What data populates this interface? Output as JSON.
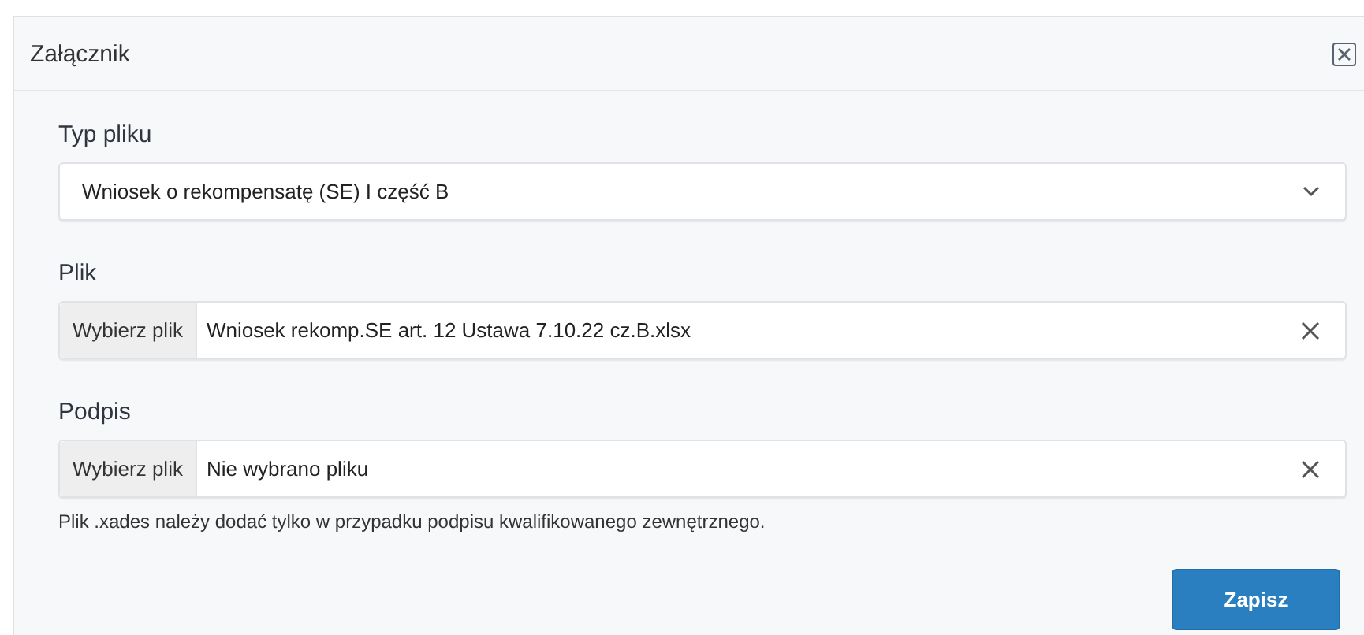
{
  "dialog": {
    "title": "Załącznik"
  },
  "fields": [
    {
      "kind": "select",
      "label": "Typ pliku",
      "value": "Wniosek o rekompensatę (SE) I część B"
    },
    {
      "kind": "file",
      "label": "Plik",
      "button": "Wybierz plik",
      "value": "Wniosek rekomp.SE art. 12 Ustawa 7.10.22 cz.B.xlsx"
    },
    {
      "kind": "file",
      "label": "Podpis",
      "button": "Wybierz plik",
      "value": "Nie wybrano pliku"
    }
  ],
  "hint": "Plik .xades należy dodać tylko w przypadku podpisu kwalifikowanego zewnętrznego.",
  "buttons": [
    "Zapisz"
  ]
}
